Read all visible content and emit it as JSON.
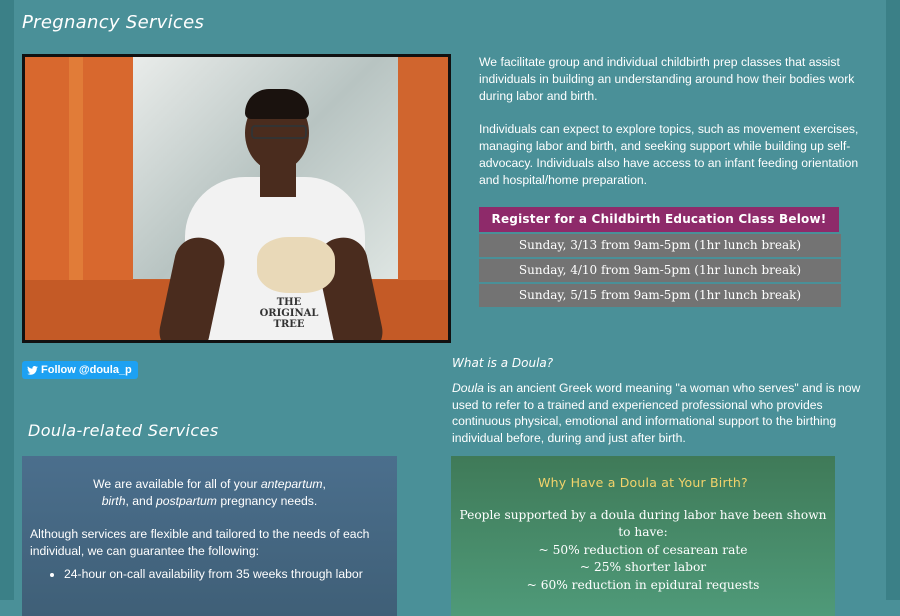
{
  "page": {
    "title": "Pregnancy Services"
  },
  "photo": {
    "alt": "Woman with glasses holding a pelvis model while teaching",
    "shirt_text": "THE ORIGINAL TREE"
  },
  "intro": {
    "p1": "We facilitate group and individual childbirth prep classes that assist individuals in building an understanding around how their bodies work during labor and birth.",
    "p2": "Individuals can expect to explore topics, such as movement exercises, managing labor and birth, and seeking support while building up self-advocacy. Individuals also have access to an infant feeding orientation and hospital/home preparation."
  },
  "registration": {
    "header": "Register for a Childbirth Education Class Below!",
    "sessions": [
      "Sunday, 3/13 from 9am-5pm (1hr lunch break)",
      "Sunday, 4/10 from 9am-5pm (1hr lunch break)",
      "Sunday, 5/15 from 9am-5pm (1hr lunch break)"
    ],
    "colors": {
      "header_bg": "#8e2a6a",
      "row_bg": "#737373"
    }
  },
  "social": {
    "follow_label": "Follow @doula_p",
    "icon": "twitter-bird-icon"
  },
  "doula_info": {
    "heading": "What is a Doula?",
    "term": "Doula",
    "text": " is an ancient Greek word meaning \"a woman who serves\" and is now used to refer to a trained and experienced professional who provides continuous physical, emotional and informational support to the birthing individual before, during and just after birth."
  },
  "services": {
    "title": "Doula-related Services",
    "intro_prefix": "We are available for all of your ",
    "intro_ante": "antepartum",
    "intro_sep": ",",
    "intro_birth": "birth",
    "intro_and": ", and ",
    "intro_post": "postpartum",
    "intro_suffix": " pregnancy needs.",
    "guarantee": "Although services are flexible and tailored to the needs of each individual, we can guarantee the following:",
    "items": [
      "24-hour on-call availability from 35 weeks through labor"
    ]
  },
  "why_doula": {
    "title": "Why Have a Doula at Your Birth?",
    "lead": "People supported by a doula during labor have been shown to have:",
    "stats": [
      "~ 50% reduction of cesarean rate",
      "~ 25% shorter labor",
      "~ 60% reduction in epidural requests"
    ],
    "colors": {
      "title": "#f3d36b"
    }
  },
  "theme": {
    "background": "#4a9098",
    "accent": "#8e2a6a",
    "twitter": "#1da1f2"
  }
}
